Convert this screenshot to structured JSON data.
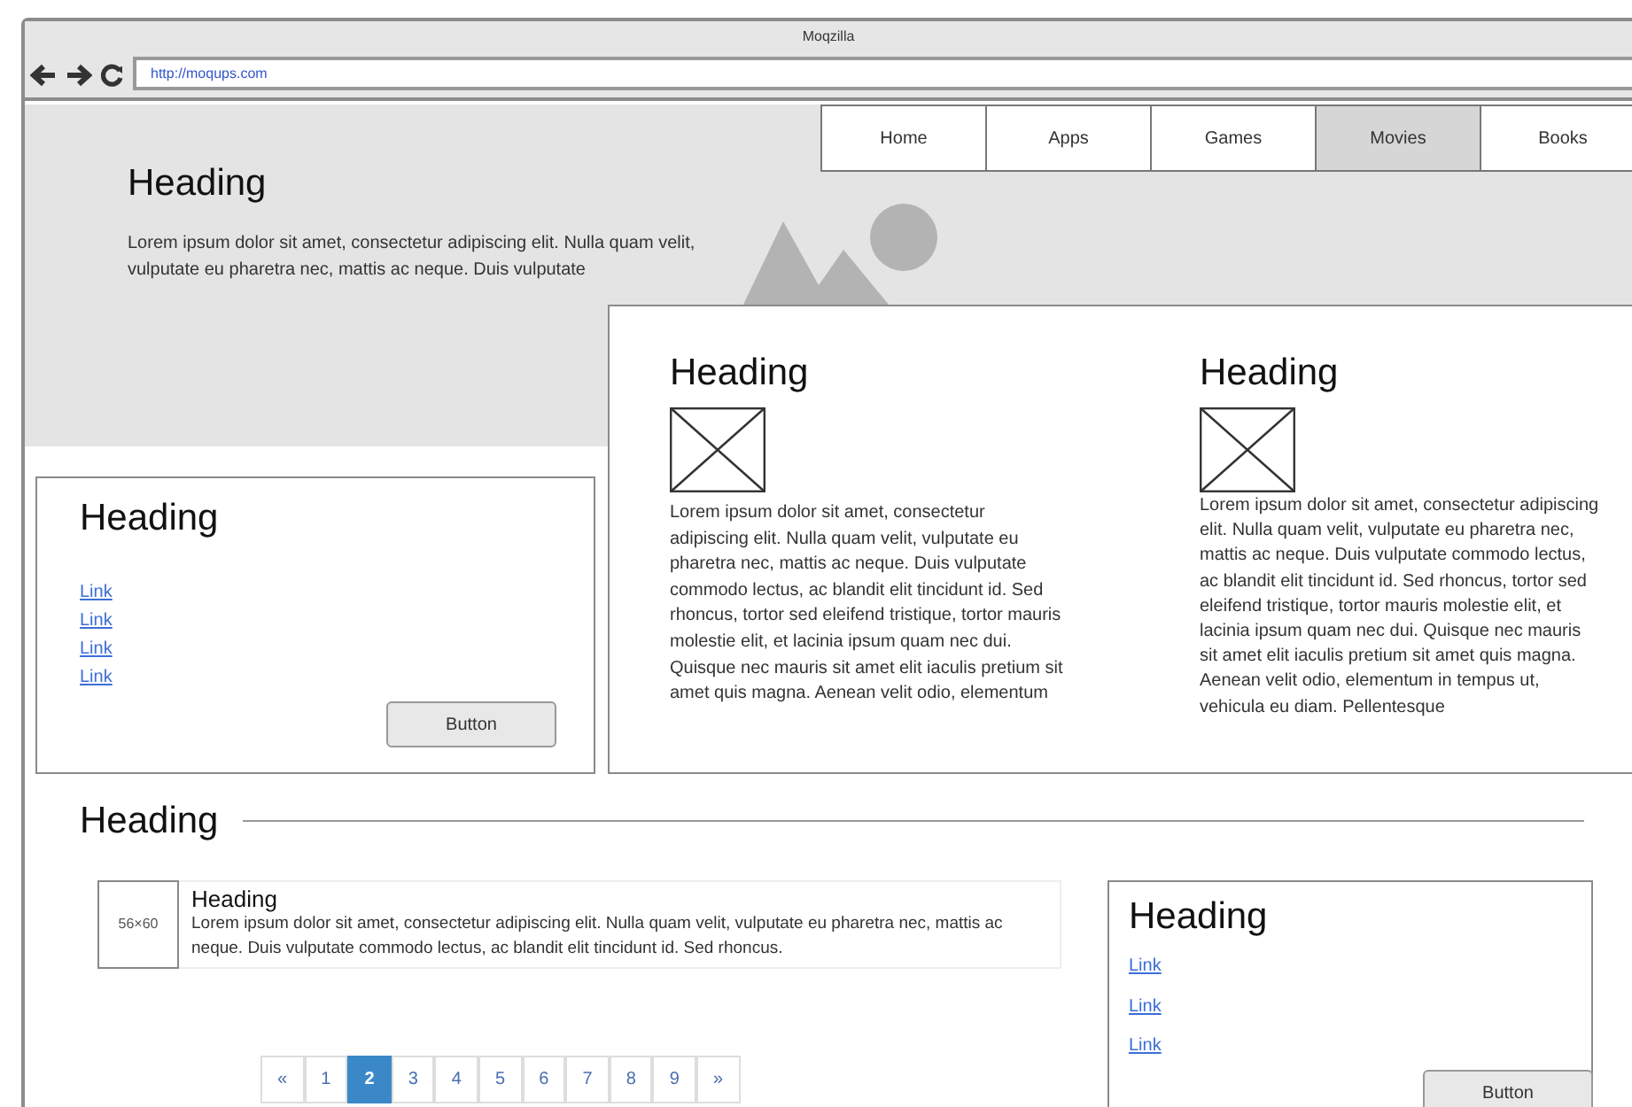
{
  "window": {
    "title": "Moqzilla",
    "url": "http://moqups.com"
  },
  "nav": [
    {
      "label": "Home",
      "selected": false
    },
    {
      "label": "Apps",
      "selected": false
    },
    {
      "label": "Games",
      "selected": false
    },
    {
      "label": "Movies",
      "selected": true
    },
    {
      "label": "Books",
      "selected": false
    }
  ],
  "hero": {
    "heading": "Heading",
    "text": "Lorem ipsum dolor sit amet, consectetur adipiscing elit. Nulla quam velit, vulputate eu pharetra nec, mattis ac neque. Duis vulputate"
  },
  "feature_card": {
    "columns": [
      {
        "heading": "Heading",
        "text": "Lorem ipsum dolor sit amet, consectetur adipiscing elit. Nulla quam velit, vulputate eu pharetra nec, mattis ac neque. Duis vulputate commodo lectus, ac blandit elit tincidunt id. Sed rhoncus, tortor sed eleifend tristique, tortor mauris molestie elit, et lacinia ipsum quam nec dui. Quisque nec mauris sit amet elit iaculis pretium sit amet quis magna. Aenean velit odio, elementum"
      },
      {
        "heading": "Heading",
        "text": "Lorem ipsum dolor sit amet, consectetur adipiscing elit. Nulla quam velit, vulputate eu pharetra nec, mattis ac neque. Duis vulputate commodo lectus, ac blandit elit tincidunt id. Sed rhoncus, tortor sed eleifend tristique, tortor mauris molestie elit, et lacinia ipsum quam nec dui. Quisque nec mauris sit amet elit iaculis pretium sit amet quis magna. Aenean velit odio, elementum in tempus ut, vehicula eu diam. Pellentesque"
      }
    ]
  },
  "links_card": {
    "heading": "Heading",
    "links": [
      "Link",
      "Link",
      "Link",
      "Link"
    ],
    "button": "Button"
  },
  "section": {
    "heading": "Heading"
  },
  "media": {
    "thumbnail_label": "56×60",
    "heading": "Heading",
    "text": "Lorem ipsum dolor sit amet, consectetur adipiscing elit. Nulla quam velit, vulputate eu pharetra nec, mattis ac neque. Duis vulputate commodo lectus, ac blandit elit tincidunt id. Sed rhoncus."
  },
  "pagination": [
    {
      "label": "«",
      "selected": false
    },
    {
      "label": "1",
      "selected": false
    },
    {
      "label": "2",
      "selected": true
    },
    {
      "label": "3",
      "selected": false
    },
    {
      "label": "4",
      "selected": false
    },
    {
      "label": "5",
      "selected": false
    },
    {
      "label": "6",
      "selected": false
    },
    {
      "label": "7",
      "selected": false
    },
    {
      "label": "8",
      "selected": false
    },
    {
      "label": "9",
      "selected": false
    },
    {
      "label": "»",
      "selected": false
    }
  ],
  "side_card": {
    "heading": "Heading",
    "links": [
      "Link",
      "Link",
      "Link"
    ],
    "button": "Button"
  }
}
